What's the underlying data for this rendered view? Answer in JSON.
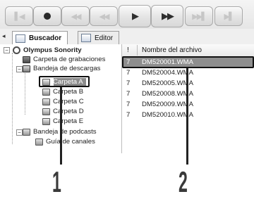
{
  "toolbar": {
    "buttons": [
      {
        "name": "stop-icon",
        "glyph": "▌◀"
      },
      {
        "name": "record-icon",
        "glyph": "●"
      },
      {
        "name": "skip-back-icon",
        "glyph": "◀◀"
      },
      {
        "name": "rewind-icon",
        "glyph": "◀◀"
      },
      {
        "name": "play-icon",
        "glyph": "▶"
      },
      {
        "name": "fast-forward-icon",
        "glyph": "▶▶"
      },
      {
        "name": "skip-forward-icon",
        "glyph": "▶▶▌"
      },
      {
        "name": "next-icon",
        "glyph": "▶▌"
      }
    ]
  },
  "tabs": [
    {
      "label": "Buscador",
      "active": true
    },
    {
      "label": "Editor",
      "active": false
    }
  ],
  "nav_glyph": "◂",
  "tree": {
    "root": "Olympus Sonority",
    "recordings": "Carpeta de grabaciones",
    "downloads": "Bandeja de descargas",
    "folders": [
      "Carpeta A",
      "Carpeta B",
      "Carpeta C",
      "Carpeta D",
      "Carpeta E"
    ],
    "podcasts": "Bandeja de podcasts",
    "channels": "Guía de canales"
  },
  "list": {
    "headers": {
      "mark": "!",
      "name": "Nombre del archivo"
    },
    "rows": [
      {
        "num": "7",
        "name": "DM520001.WMA",
        "selected": true
      },
      {
        "num": "7",
        "name": "DM520004.WMA",
        "selected": false
      },
      {
        "num": "7",
        "name": "DM520005.WMA",
        "selected": false
      },
      {
        "num": "7",
        "name": "DM520008.WMA",
        "selected": false
      },
      {
        "num": "7",
        "name": "DM520009.WMA",
        "selected": false
      },
      {
        "num": "7",
        "name": "DM520010.WMA",
        "selected": false
      }
    ]
  },
  "callouts": {
    "one": "1",
    "two": "2"
  }
}
